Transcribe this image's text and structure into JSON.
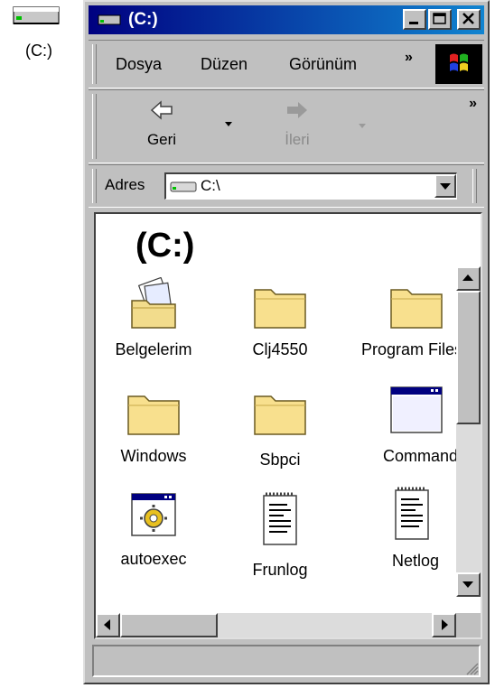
{
  "desktop": {
    "drive_label": "(C:)"
  },
  "window": {
    "title": "(C:)",
    "menu": [
      "Dosya",
      "Düzen",
      "Görünüm"
    ],
    "toolbar": {
      "back_label": "Geri",
      "forward_label": "İleri"
    },
    "address": {
      "label": "Adres",
      "value": "C:\\"
    },
    "heading": "(C:)",
    "items": [
      {
        "label": "Belgelerim",
        "icon": "my-documents-icon"
      },
      {
        "label": "Clj4550",
        "icon": "folder-icon"
      },
      {
        "label": "Program Files",
        "icon": "folder-icon"
      },
      {
        "label": "Windows",
        "icon": "folder-icon"
      },
      {
        "label": "Sbpci",
        "icon": "folder-icon"
      },
      {
        "label": "Command",
        "icon": "application-window-icon"
      },
      {
        "label": "autoexec",
        "icon": "system-file-icon"
      },
      {
        "label": "Frunlog",
        "icon": "text-document-icon"
      },
      {
        "label": "Netlog",
        "icon": "text-document-icon"
      }
    ]
  }
}
